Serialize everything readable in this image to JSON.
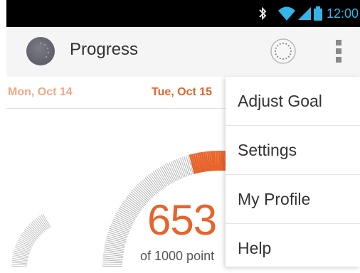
{
  "status_bar": {
    "time": "12:00",
    "icons": [
      "bluetooth-icon",
      "wifi-icon",
      "signal-icon",
      "battery-icon"
    ],
    "accent_color": "#33b5e5"
  },
  "action_bar": {
    "title": "Progress",
    "logo_icon": "app-logo-icon",
    "sync_icon": "sync-device-icon",
    "overflow_icon": "overflow-menu-icon"
  },
  "dates": {
    "previous": "Mon, Oct 14",
    "current": "Tue, Oct 15"
  },
  "progress": {
    "points": "653",
    "caption": "of 1000 point",
    "fraction": 0.653,
    "accent_color": "#e8632a"
  },
  "menu": {
    "items": [
      {
        "label": "Adjust Goal"
      },
      {
        "label": "Settings"
      },
      {
        "label": "My Profile"
      },
      {
        "label": "Help"
      }
    ]
  }
}
